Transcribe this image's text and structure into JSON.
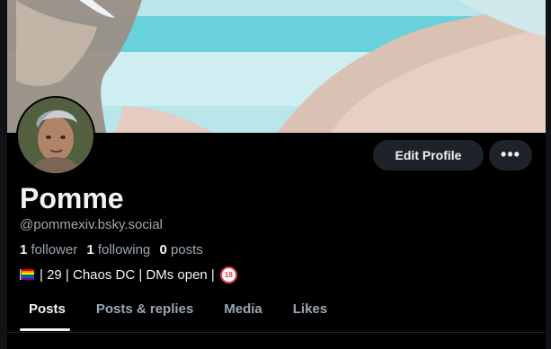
{
  "profile": {
    "display_name": "Pomme",
    "handle": "@pommexiv.bsky.social",
    "stats": {
      "followers_count": "1",
      "followers_label": "follower",
      "following_count": "1",
      "following_label": "following",
      "posts_count": "0",
      "posts_label": "posts"
    },
    "bio": "| 29 | Chaos DC | DMs open |"
  },
  "actions": {
    "edit_label": "Edit Profile",
    "more_label": "•••"
  },
  "tabs": [
    {
      "label": "Posts",
      "active": true
    },
    {
      "label": "Posts & replies",
      "active": false
    },
    {
      "label": "Media",
      "active": false
    },
    {
      "label": "Likes",
      "active": false
    }
  ],
  "colors": {
    "background": "#000000",
    "button_bg": "#1e2329",
    "muted_text": "#9aa6b2",
    "primary_text": "#f1f3f5"
  },
  "icons": {
    "bio_flag": "rainbow-flag-icon",
    "bio_age": "no-under-18-icon",
    "more": "more-options-icon"
  }
}
